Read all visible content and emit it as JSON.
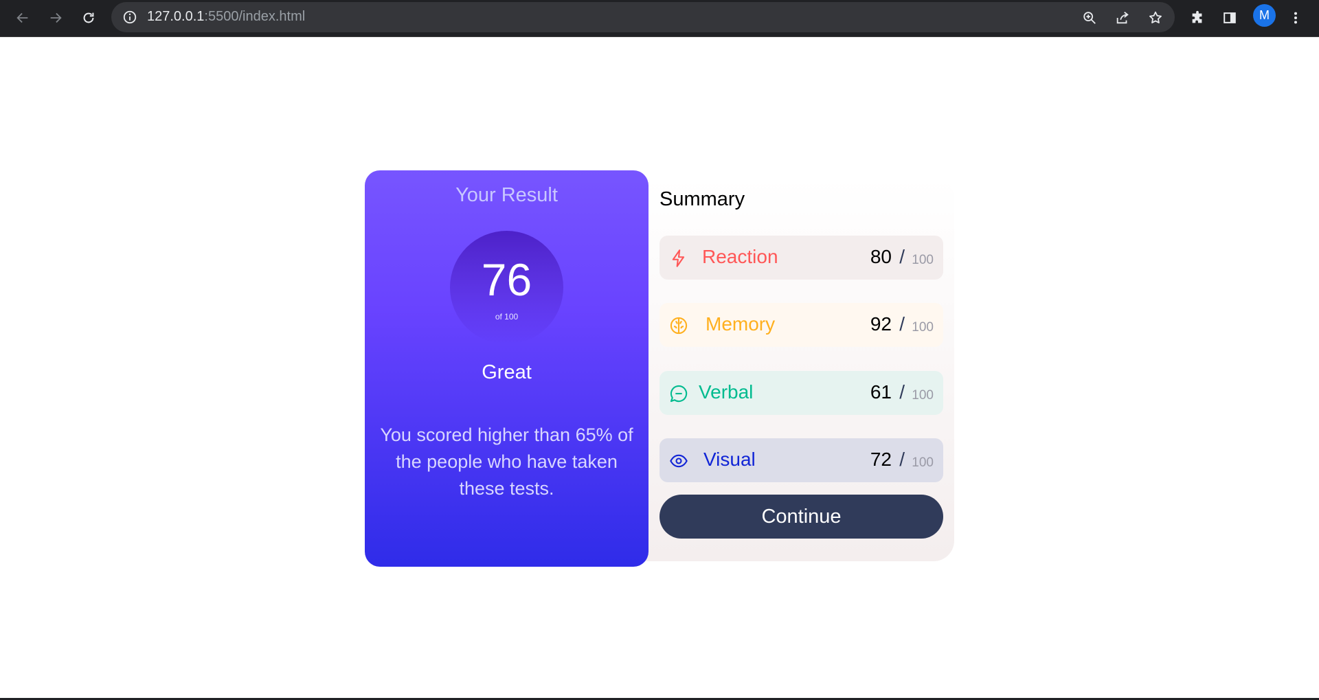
{
  "browser": {
    "url_host": "127.0.0.1",
    "url_rest": ":5500/index.html",
    "profile_initial": "M"
  },
  "result": {
    "title": "Your Result",
    "score": "76",
    "score_of": "of 100",
    "grade": "Great",
    "description": "You scored higher than 65% of the people who have taken these tests."
  },
  "summary": {
    "title": "Summary",
    "items": [
      {
        "label": "Reaction",
        "score": "80",
        "slash": "/",
        "max": "100",
        "icon": "lightning-icon",
        "color": "#ff5757"
      },
      {
        "label": "Memory",
        "score": "92",
        "slash": "/",
        "max": "100",
        "icon": "brain-icon",
        "color": "#ffb01f"
      },
      {
        "label": "Verbal",
        "score": "61",
        "slash": "/",
        "max": "100",
        "icon": "chat-bubble-icon",
        "color": "#00bb8f"
      },
      {
        "label": "Visual",
        "score": "72",
        "slash": "/",
        "max": "100",
        "icon": "eye-icon",
        "color": "#1125d6"
      }
    ],
    "continue_label": "Continue"
  }
}
